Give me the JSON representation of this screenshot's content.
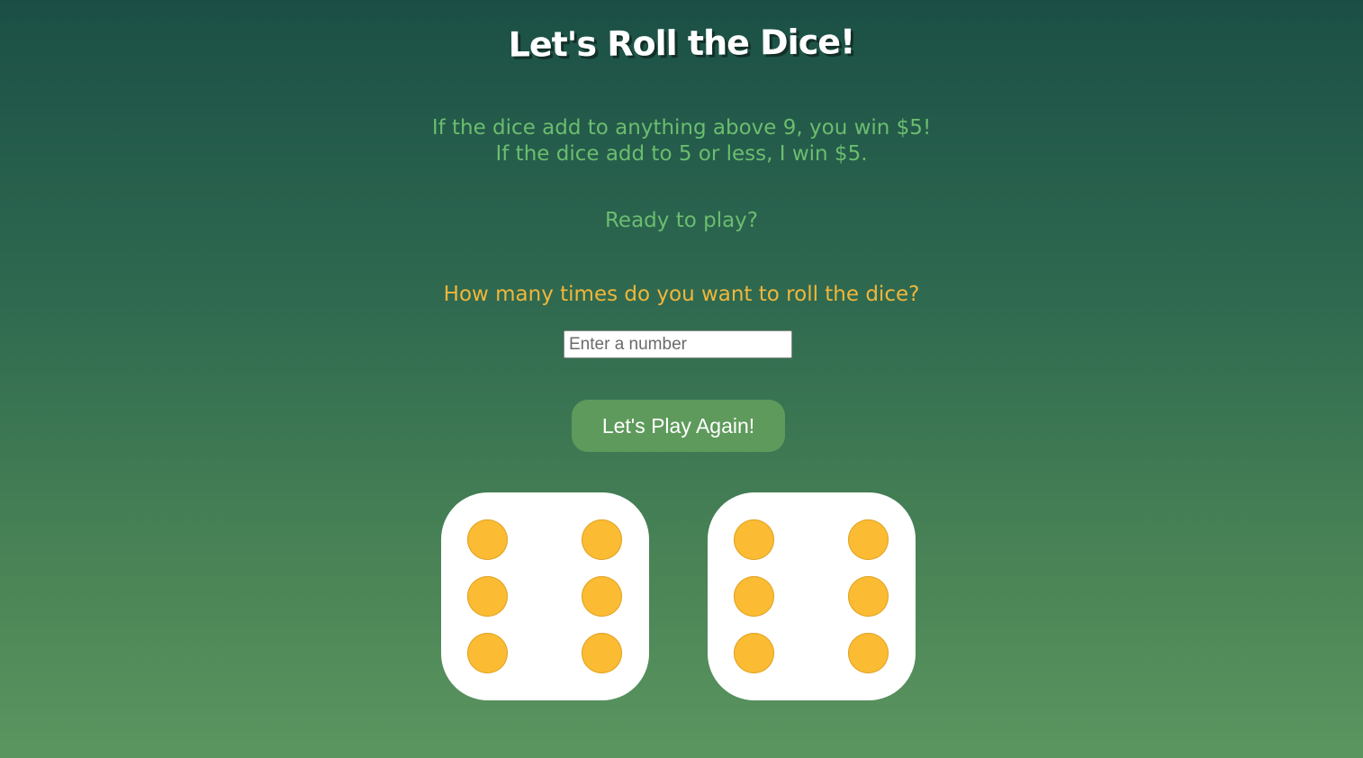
{
  "header": {
    "title": "Let's Roll the Dice!"
  },
  "rules": {
    "line1": "If the dice add to anything above 9, you win $5!",
    "line2": "If the dice add to 5 or less, I win $5."
  },
  "prompt": {
    "ready": "Ready to play?",
    "question": "How many times do you want to roll the dice?"
  },
  "input": {
    "placeholder": "Enter a number",
    "value": ""
  },
  "button": {
    "label": "Let's Play Again!"
  },
  "dice": [
    {
      "value": 6
    },
    {
      "value": 6
    }
  ],
  "colors": {
    "pip": "#fbbb33",
    "rules_text": "#6bbd6f",
    "question_text": "#f2b63a",
    "button_bg": "#5e9a5c"
  }
}
